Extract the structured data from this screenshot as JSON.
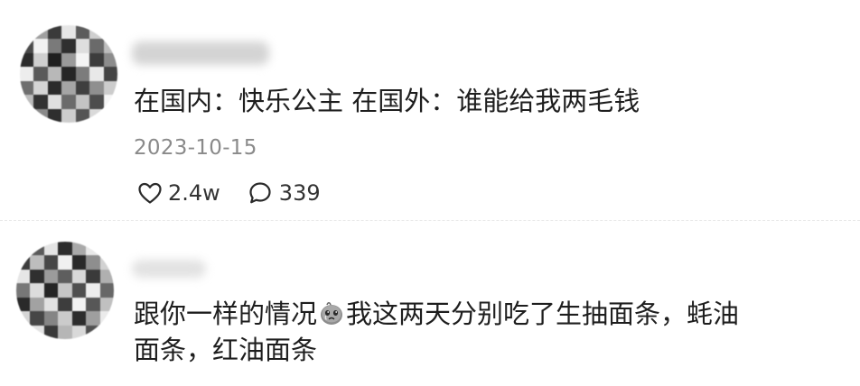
{
  "comments": [
    {
      "text": "在国内：快乐公主 在国外：谁能给我两毛钱",
      "date": "2023-10-15",
      "likes": "2.4w",
      "replies": "339"
    },
    {
      "text_line1_before": "跟你一样的情况",
      "emoji_icon": "crying-face-emoji-icon",
      "text_line1_after": "我这两天分别吃了生抽面条，蚝油",
      "text_line2": "面条，红油面条"
    }
  ],
  "icons": {
    "like": "heart-outline-icon",
    "reply": "speech-bubble-outline-icon"
  },
  "colors": {
    "text": "#1e1e1e",
    "secondary_text": "#8a8a8a",
    "divider": "#e9e9e9"
  }
}
